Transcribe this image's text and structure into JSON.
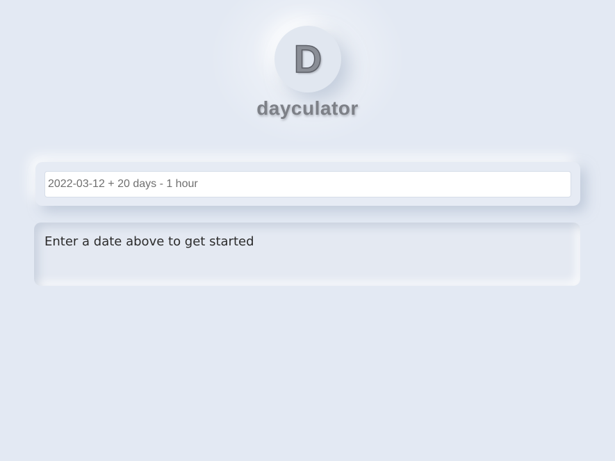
{
  "app": {
    "logo_letter": "D",
    "title": "dayculator"
  },
  "input": {
    "value": "",
    "placeholder": "2022-03-12 + 20 days - 1 hour"
  },
  "result": {
    "message": "Enter a date above to get started"
  },
  "colors": {
    "background": "#e3e9f3",
    "title_text": "#7d8087",
    "result_text": "#2b2b2b"
  }
}
